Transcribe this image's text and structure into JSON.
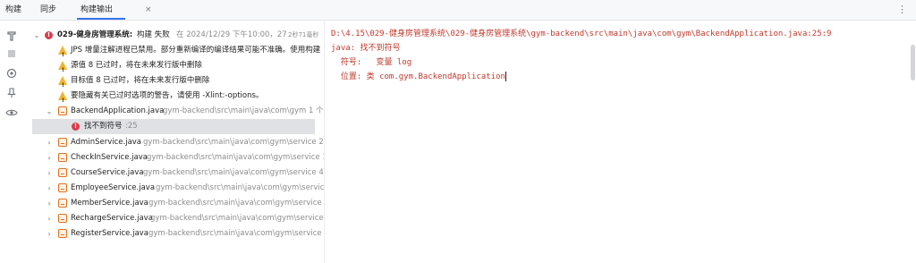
{
  "tabs": {
    "title": "构建",
    "sync": "同步",
    "output": "构建输出",
    "close": "×"
  },
  "icons": {
    "more": "⋮"
  },
  "tree": {
    "root": {
      "name": "029-健身房管理系统:",
      "status": "构建 失败",
      "detail": "在 2024/12/29 下午10:00，27",
      "duration": "2秒71毫秒"
    },
    "warnings": [
      "JPS 增量注解进程已禁用。部分重新编译的编译结果可能不准确。使用构建",
      "源值 8 已过时，将在未来发行版中删除",
      "目标值 8 已过时，将在未来发行版中删除",
      "要隐藏有关已过时选项的警告，请使用 -Xlint:-options。"
    ],
    "file": {
      "name": "BackendApplication.java",
      "path": "gym-backend\\src\\main\\java\\com\\gym 1 个"
    },
    "error": {
      "message": "找不到符号",
      "line": ":25"
    },
    "services": [
      {
        "name": "AdminService.java",
        "path": "gym-backend\\src\\main\\java\\com\\gym\\service 2"
      },
      {
        "name": "CheckInService.java",
        "path": "gym-backend\\src\\main\\java\\com\\gym\\service 1"
      },
      {
        "name": "CourseService.java",
        "path": "gym-backend\\src\\main\\java\\com\\gym\\service 4"
      },
      {
        "name": "EmployeeService.java",
        "path": "gym-backend\\src\\main\\java\\com\\gym\\service"
      },
      {
        "name": "MemberService.java",
        "path": "gym-backend\\src\\main\\java\\com\\gym\\service"
      },
      {
        "name": "RechargeService.java",
        "path": "gym-backend\\src\\main\\java\\com\\gym\\service"
      },
      {
        "name": "RegisterService.java",
        "path": "gym-backend\\src\\main\\java\\com\\gym\\service"
      }
    ]
  },
  "output": {
    "lines": [
      "D:\\4.15\\029-健身房管理系统\\029-健身房管理系统\\gym-backend\\src\\main\\java\\com\\gym\\BackendApplication.java:25:9",
      "java: 找不到符号",
      "  符号:   变量 log",
      "  位置: 类 com.gym.BackendApplication"
    ]
  }
}
